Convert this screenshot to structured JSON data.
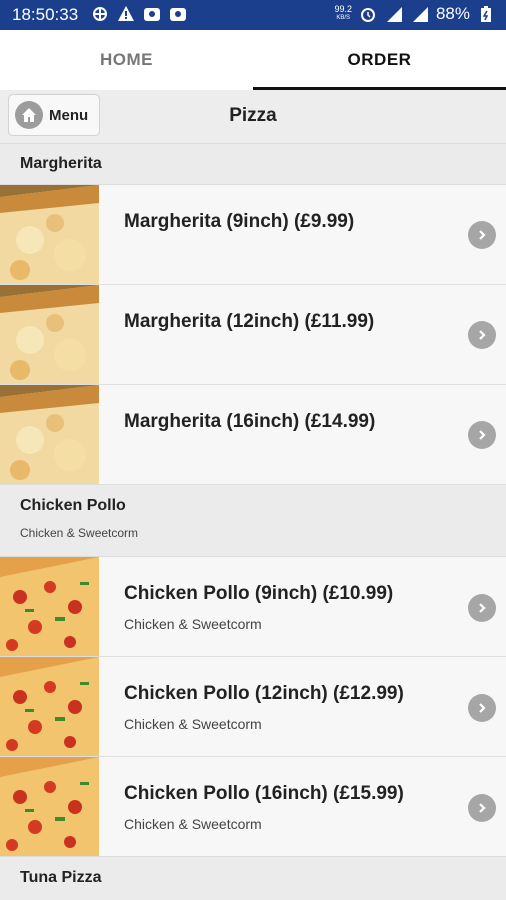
{
  "status_bar": {
    "time": "18:50:33",
    "net_speed_value": "99.2",
    "net_speed_unit": "KB/S",
    "battery": "88%"
  },
  "tabs": [
    {
      "label": "HOME"
    },
    {
      "label": "ORDER",
      "active": true
    }
  ],
  "header": {
    "menu_label": "Menu",
    "title": "Pizza"
  },
  "sections": [
    {
      "title": "Margherita",
      "subtitle": "",
      "items": [
        {
          "title": "Margherita (9inch) (£9.99)",
          "subtitle": ""
        },
        {
          "title": "Margherita (12inch) (£11.99)",
          "subtitle": ""
        },
        {
          "title": "Margherita (16inch) (£14.99)",
          "subtitle": ""
        }
      ]
    },
    {
      "title": "Chicken Pollo",
      "subtitle": "Chicken & Sweetcorm",
      "items": [
        {
          "title": "Chicken Pollo (9inch) (£10.99)",
          "subtitle": "Chicken & Sweetcorm"
        },
        {
          "title": "Chicken Pollo (12inch) (£12.99)",
          "subtitle": "Chicken & Sweetcorm"
        },
        {
          "title": "Chicken Pollo (16inch) (£15.99)",
          "subtitle": "Chicken & Sweetcorm"
        }
      ]
    },
    {
      "title": "Tuna Pizza",
      "subtitle": "",
      "items": []
    }
  ],
  "colors": {
    "status_bar": "#1b3f8c",
    "header_bg": "#ededed",
    "chevron": "#a6a6a6"
  }
}
